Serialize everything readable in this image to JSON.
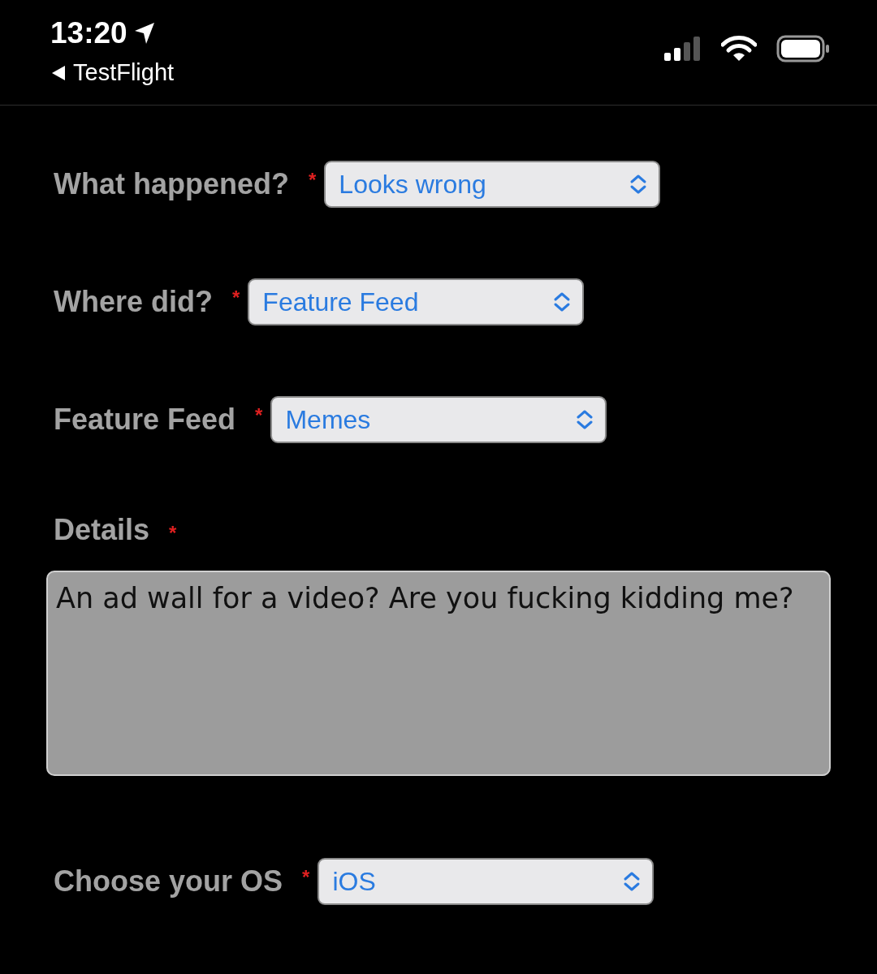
{
  "status_bar": {
    "time": "13:20",
    "back_label": "TestFlight"
  },
  "fields": [
    {
      "kind": "select",
      "label": "What happened?",
      "required_mark": "*",
      "value": "Looks wrong"
    },
    {
      "kind": "select",
      "label": "Where did?",
      "required_mark": "*",
      "value": "Feature Feed"
    },
    {
      "kind": "select",
      "label": "Feature Feed",
      "required_mark": "*",
      "value": "Memes"
    },
    {
      "kind": "textarea",
      "label": "Details",
      "required_mark": "*",
      "value": "An ad wall for a video? Are you fucking kidding me?"
    },
    {
      "kind": "select",
      "label": "Choose your OS",
      "required_mark": "*",
      "value": "iOS"
    }
  ]
}
